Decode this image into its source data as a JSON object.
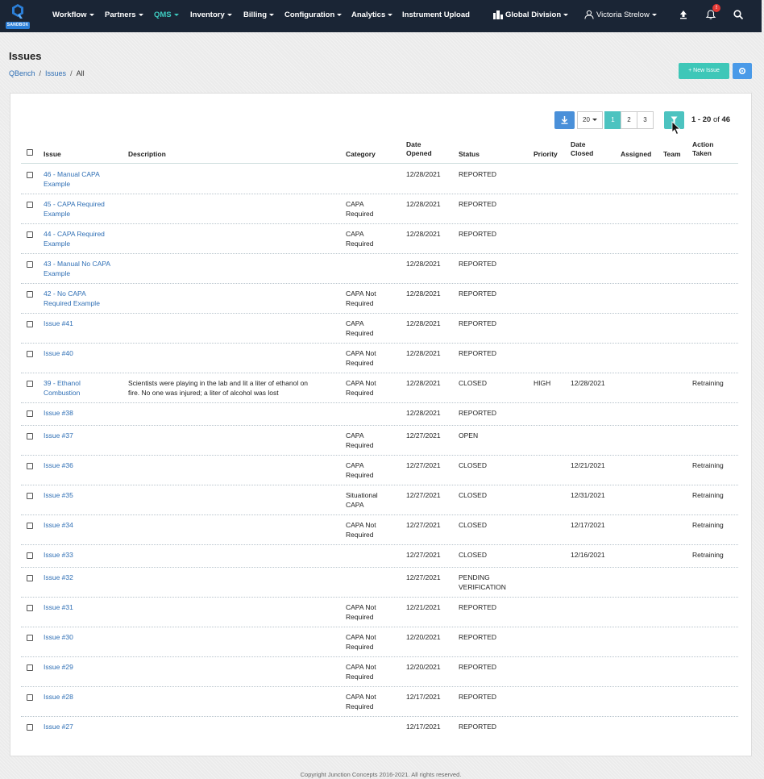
{
  "navbar": {
    "sandbox_label": "SANDBOX",
    "items": [
      {
        "label": "Workflow"
      },
      {
        "label": "Partners"
      },
      {
        "label": "QMS"
      },
      {
        "label": "Inventory"
      },
      {
        "label": "Billing"
      },
      {
        "label": "Configuration"
      },
      {
        "label": "Analytics"
      },
      {
        "label": "Instrument Upload"
      }
    ],
    "division": "Global Division",
    "user": "Victoria Strelow",
    "notification_count": "!",
    "active_color": "#3ecbc0"
  },
  "page": {
    "title": "Issues",
    "breadcrumb": [
      "QBench",
      "Issues",
      "All"
    ],
    "new_button": "+ New Issue"
  },
  "pagination": {
    "page_size": "20",
    "pages": [
      "1",
      "2",
      "3"
    ],
    "range_bold": "1 - 20",
    "range_of": "of",
    "total": "46"
  },
  "table": {
    "headers": {
      "issue": "Issue",
      "description": "Description",
      "category": "Category",
      "date_opened_1": "Date",
      "date_opened_2": "Opened",
      "status": "Status",
      "priority": "Priority",
      "date_closed_1": "Date",
      "date_closed_2": "Closed",
      "assigned": "Assigned",
      "team": "Team",
      "action_1": "Action",
      "action_2": "Taken"
    },
    "rows": [
      {
        "issue": [
          "46 - Manual CAPA",
          "Example"
        ],
        "description": [],
        "category": [],
        "opened": "12/28/2021",
        "status": [
          "REPORTED"
        ],
        "priority": "",
        "closed": "",
        "action": ""
      },
      {
        "issue": [
          "45 - CAPA Required",
          "Example"
        ],
        "description": [],
        "category": [
          "CAPA",
          "Required"
        ],
        "opened": "12/28/2021",
        "status": [
          "REPORTED"
        ],
        "priority": "",
        "closed": "",
        "action": ""
      },
      {
        "issue": [
          "44 - CAPA Required",
          "Example"
        ],
        "description": [],
        "category": [
          "CAPA",
          "Required"
        ],
        "opened": "12/28/2021",
        "status": [
          "REPORTED"
        ],
        "priority": "",
        "closed": "",
        "action": ""
      },
      {
        "issue": [
          "43 - Manual No CAPA",
          "Example"
        ],
        "description": [],
        "category": [],
        "opened": "12/28/2021",
        "status": [
          "REPORTED"
        ],
        "priority": "",
        "closed": "",
        "action": ""
      },
      {
        "issue": [
          "42 - No CAPA",
          "Required Example"
        ],
        "description": [],
        "category": [
          "CAPA Not",
          "Required"
        ],
        "opened": "12/28/2021",
        "status": [
          "REPORTED"
        ],
        "priority": "",
        "closed": "",
        "action": ""
      },
      {
        "issue": [
          "Issue #41"
        ],
        "description": [],
        "category": [
          "CAPA",
          "Required"
        ],
        "opened": "12/28/2021",
        "status": [
          "REPORTED"
        ],
        "priority": "",
        "closed": "",
        "action": ""
      },
      {
        "issue": [
          "Issue #40"
        ],
        "description": [],
        "category": [
          "CAPA Not",
          "Required"
        ],
        "opened": "12/28/2021",
        "status": [
          "REPORTED"
        ],
        "priority": "",
        "closed": "",
        "action": ""
      },
      {
        "issue": [
          "39 - Ethanol",
          "Combustion"
        ],
        "description": [
          "Scientists were playing in the lab and lit a liter of ethanol on",
          "fire. No one was injured; a liter of alcohol was lost"
        ],
        "category": [
          "CAPA Not",
          "Required"
        ],
        "opened": "12/28/2021",
        "status": [
          "CLOSED"
        ],
        "priority": "HIGH",
        "closed": "12/28/2021",
        "action": "Retraining"
      },
      {
        "issue": [
          "Issue #38"
        ],
        "description": [],
        "category": [],
        "opened": "12/28/2021",
        "status": [
          "REPORTED"
        ],
        "priority": "",
        "closed": "",
        "action": ""
      },
      {
        "issue": [
          "Issue #37"
        ],
        "description": [],
        "category": [
          "CAPA",
          "Required"
        ],
        "opened": "12/27/2021",
        "status": [
          "OPEN"
        ],
        "priority": "",
        "closed": "",
        "action": ""
      },
      {
        "issue": [
          "Issue #36"
        ],
        "description": [],
        "category": [
          "CAPA",
          "Required"
        ],
        "opened": "12/27/2021",
        "status": [
          "CLOSED"
        ],
        "priority": "",
        "closed": "12/21/2021",
        "action": "Retraining"
      },
      {
        "issue": [
          "Issue #35"
        ],
        "description": [],
        "category": [
          "Situational",
          "CAPA"
        ],
        "opened": "12/27/2021",
        "status": [
          "CLOSED"
        ],
        "priority": "",
        "closed": "12/31/2021",
        "action": "Retraining"
      },
      {
        "issue": [
          "Issue #34"
        ],
        "description": [],
        "category": [
          "CAPA Not",
          "Required"
        ],
        "opened": "12/27/2021",
        "status": [
          "CLOSED"
        ],
        "priority": "",
        "closed": "12/17/2021",
        "action": "Retraining"
      },
      {
        "issue": [
          "Issue #33"
        ],
        "description": [],
        "category": [],
        "opened": "12/27/2021",
        "status": [
          "CLOSED"
        ],
        "priority": "",
        "closed": "12/16/2021",
        "action": "Retraining"
      },
      {
        "issue": [
          "Issue #32"
        ],
        "description": [],
        "category": [],
        "opened": "12/27/2021",
        "status": [
          "PENDING",
          "VERIFICATION"
        ],
        "priority": "",
        "closed": "",
        "action": ""
      },
      {
        "issue": [
          "Issue #31"
        ],
        "description": [],
        "category": [
          "CAPA Not",
          "Required"
        ],
        "opened": "12/21/2021",
        "status": [
          "REPORTED"
        ],
        "priority": "",
        "closed": "",
        "action": ""
      },
      {
        "issue": [
          "Issue #30"
        ],
        "description": [],
        "category": [
          "CAPA Not",
          "Required"
        ],
        "opened": "12/20/2021",
        "status": [
          "REPORTED"
        ],
        "priority": "",
        "closed": "",
        "action": ""
      },
      {
        "issue": [
          "Issue #29"
        ],
        "description": [],
        "category": [
          "CAPA Not",
          "Required"
        ],
        "opened": "12/20/2021",
        "status": [
          "REPORTED"
        ],
        "priority": "",
        "closed": "",
        "action": ""
      },
      {
        "issue": [
          "Issue #28"
        ],
        "description": [],
        "category": [
          "CAPA Not",
          "Required"
        ],
        "opened": "12/17/2021",
        "status": [
          "REPORTED"
        ],
        "priority": "",
        "closed": "",
        "action": ""
      },
      {
        "issue": [
          "Issue #27"
        ],
        "description": [],
        "category": [],
        "opened": "12/17/2021",
        "status": [
          "REPORTED"
        ],
        "priority": "",
        "closed": "",
        "action": ""
      }
    ]
  },
  "footer": {
    "copyright": "Copyright Junction Concepts 2016-2021. All rights reserved."
  },
  "colors": {
    "navbar_bg": "#1a2535",
    "link": "#2f6fb5",
    "teal": "#3ec7b8",
    "blue": "#4a90d9"
  }
}
